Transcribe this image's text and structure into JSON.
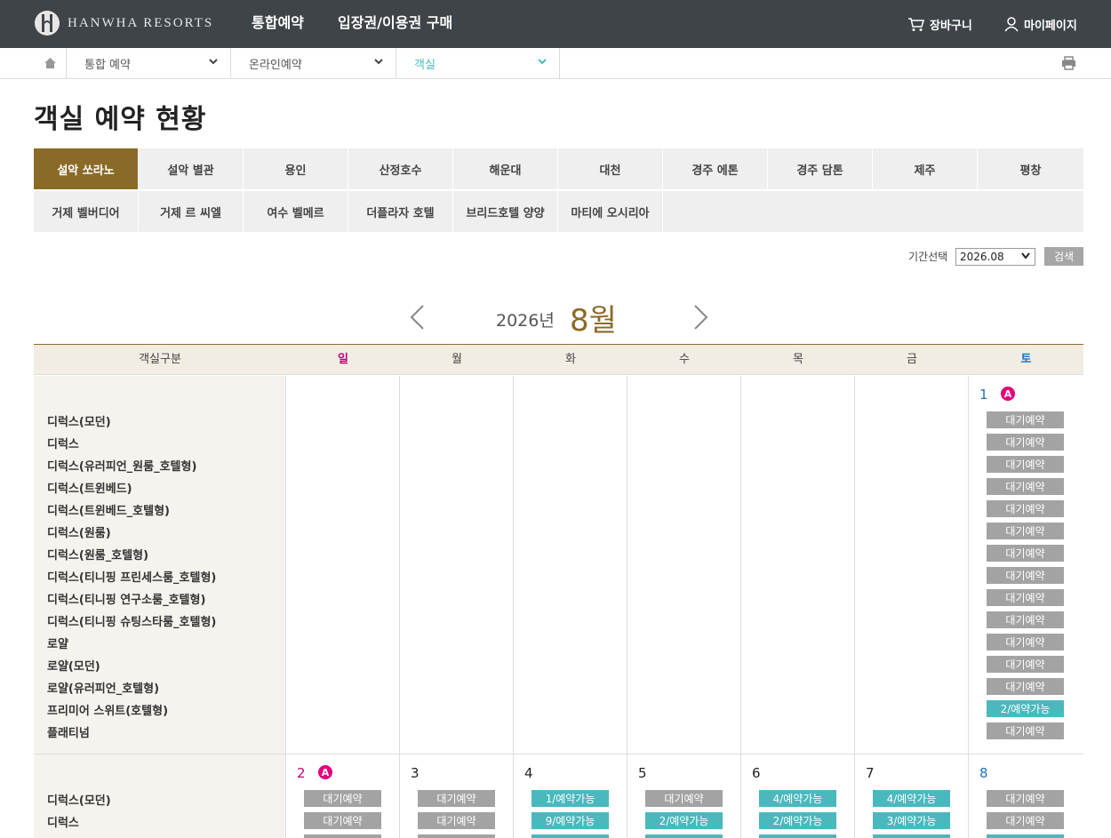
{
  "header": {
    "logo_text": "HANWHA RESORTS",
    "menu": [
      "통합예약",
      "입장권/이용권 구매"
    ],
    "cart_label": "장바구니",
    "mypage_label": "마이페이지"
  },
  "breadcrumb": [
    "통합 예약",
    "온라인예약",
    "객실"
  ],
  "page_title": "객실 예약 현황",
  "resort_tabs": [
    [
      "설악 쏘라노",
      "설악 별관",
      "용인",
      "산정호수",
      "해운대",
      "대천",
      "경주 에톤",
      "경주 담톤",
      "제주",
      "평창"
    ],
    [
      "거제 벨버디어",
      "거제 르 씨엘",
      "여수 벨메르",
      "더플라자 호텔",
      "브리드호텔 양양",
      "마티에 오시리아"
    ]
  ],
  "active_tab": "설악 쏘라노",
  "period": {
    "label": "기간선택",
    "value": "2026.08",
    "search_label": "검색"
  },
  "calendar": {
    "year_label": "2026년",
    "month_label": "8월",
    "header": [
      "객실구분",
      "일",
      "월",
      "화",
      "수",
      "목",
      "금",
      "토"
    ],
    "rooms": [
      "디럭스(모던)",
      "디럭스",
      "디럭스(유러피언_원룸_호텔형)",
      "디럭스(트윈베드)",
      "디럭스(트윈베드_호텔형)",
      "디럭스(원룸)",
      "디럭스(원룸_호텔형)",
      "디럭스(티니핑 프린세스룸_호텔형)",
      "디럭스(티니핑 연구소룸_호텔형)",
      "디럭스(티니핑 슈팅스타룸_호텔형)",
      "로얄",
      "로얄(모던)",
      "로얄(유러피언_호텔형)",
      "프리미어 스위트(호텔형)",
      "플래티넘"
    ],
    "week1": {
      "day": "1",
      "badge": "A",
      "statuses": [
        "대기예약",
        "대기예약",
        "대기예약",
        "대기예약",
        "대기예약",
        "대기예약",
        "대기예약",
        "대기예약",
        "대기예약",
        "대기예약",
        "대기예약",
        "대기예약",
        "대기예약",
        "2/예약가능",
        "대기예약"
      ]
    },
    "week2": {
      "days": [
        {
          "day": "2",
          "badge": "A",
          "statuses": [
            "대기예약",
            "대기예약"
          ]
        },
        {
          "day": "3",
          "badge": "",
          "statuses": [
            "대기예약",
            "대기예약"
          ]
        },
        {
          "day": "4",
          "badge": "",
          "statuses": [
            "1/예약가능",
            "9/예약가능"
          ]
        },
        {
          "day": "5",
          "badge": "",
          "statuses": [
            "대기예약",
            "2/예약가능"
          ]
        },
        {
          "day": "6",
          "badge": "",
          "statuses": [
            "4/예약가능",
            "2/예약가능"
          ]
        },
        {
          "day": "7",
          "badge": "",
          "statuses": [
            "4/예약가능",
            "3/예약가능"
          ]
        },
        {
          "day": "8",
          "badge": "",
          "statuses": [
            "대기예약",
            "대기예약"
          ]
        }
      ]
    }
  },
  "colors": {
    "accent": "#8a6a27",
    "available": "#4ab8bd",
    "waiting": "#a3a3a3",
    "sunday": "#c0007c",
    "saturday": "#1e6fc3"
  }
}
